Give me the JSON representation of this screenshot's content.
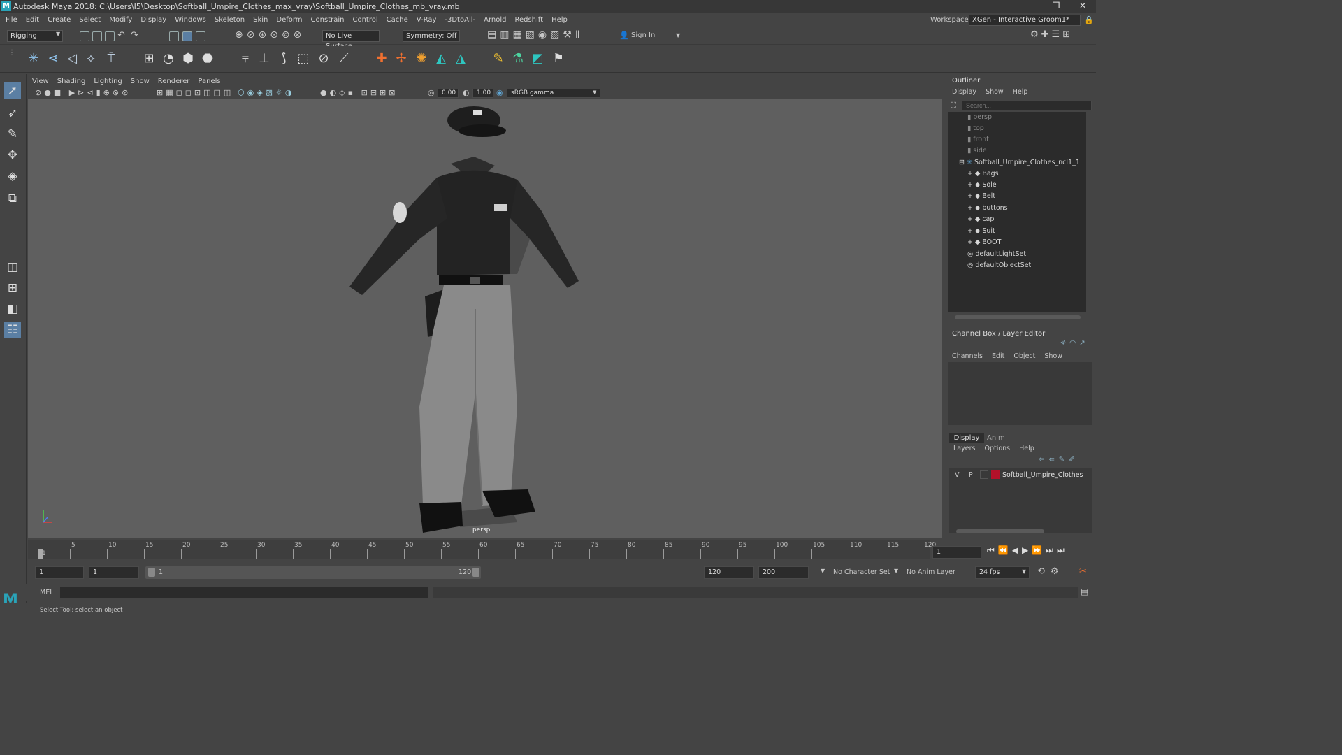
{
  "window": {
    "title": "Autodesk Maya 2018: C:\\Users\\I5\\Desktop\\Softball_Umpire_Clothes_max_vray\\Softball_Umpire_Clothes_mb_vray.mb"
  },
  "menubar": [
    "File",
    "Edit",
    "Create",
    "Select",
    "Modify",
    "Display",
    "Windows",
    "Skeleton",
    "Skin",
    "Deform",
    "Constrain",
    "Control",
    "Cache",
    "V-Ray",
    "-3DtoAll-",
    "Arnold",
    "Redshift",
    "Help"
  ],
  "workspace": {
    "label": "Workspace :",
    "value": "XGen - Interactive Groom1*"
  },
  "toolbar": {
    "mode": "Rigging",
    "live_surface": "No Live Surface",
    "symmetry": "Symmetry: Off",
    "sign_in": "Sign In"
  },
  "panel_menu": [
    "View",
    "Shading",
    "Lighting",
    "Show",
    "Renderer",
    "Panels"
  ],
  "view_bar": {
    "exposure": "0.00",
    "gamma": "1.00",
    "color_space": "sRGB gamma"
  },
  "viewport": {
    "camera": "persp"
  },
  "outliner": {
    "title": "Outliner",
    "menu": [
      "Display",
      "Show",
      "Help"
    ],
    "search_placeholder": "Search...",
    "cameras": [
      "persp",
      "top",
      "front",
      "side"
    ],
    "root": "Softball_Umpire_Clothes_ncl1_1",
    "children": [
      "Bags",
      "Sole",
      "Belt",
      "buttons",
      "cap",
      "Suit",
      "BOOT"
    ],
    "sets": [
      "defaultLightSet",
      "defaultObjectSet"
    ]
  },
  "channel_box": {
    "title": "Channel Box / Layer Editor",
    "menu": [
      "Channels",
      "Edit",
      "Object",
      "Show"
    ]
  },
  "layer_editor": {
    "tabs": [
      "Display",
      "Anim"
    ],
    "menu": [
      "Layers",
      "Options",
      "Help"
    ],
    "layer": {
      "v": "V",
      "p": "P",
      "name": "Softball_Umpire_Clothes",
      "color": "#b3112a"
    }
  },
  "timeline": {
    "ticks": [
      "1",
      "5",
      "10",
      "15",
      "20",
      "25",
      "30",
      "35",
      "40",
      "45",
      "50",
      "55",
      "60",
      "65",
      "70",
      "75",
      "80",
      "85",
      "90",
      "95",
      "100",
      "105",
      "110",
      "115",
      "120"
    ],
    "current_frame": "1"
  },
  "range": {
    "start": "1",
    "playback_start": "1",
    "slider_start": "1",
    "slider_end": "120",
    "playback_end": "120",
    "end": "200",
    "character_set": "No Character Set",
    "anim_layer": "No Anim Layer",
    "fps": "24 fps"
  },
  "command": {
    "lang": "MEL"
  },
  "help_line": "Select Tool: select an object",
  "colors": {
    "ui_bg": "#444444",
    "field_bg": "#2b2b2b",
    "viewport_bg": "#5f5f5f",
    "accent": "#5ea6d6"
  }
}
